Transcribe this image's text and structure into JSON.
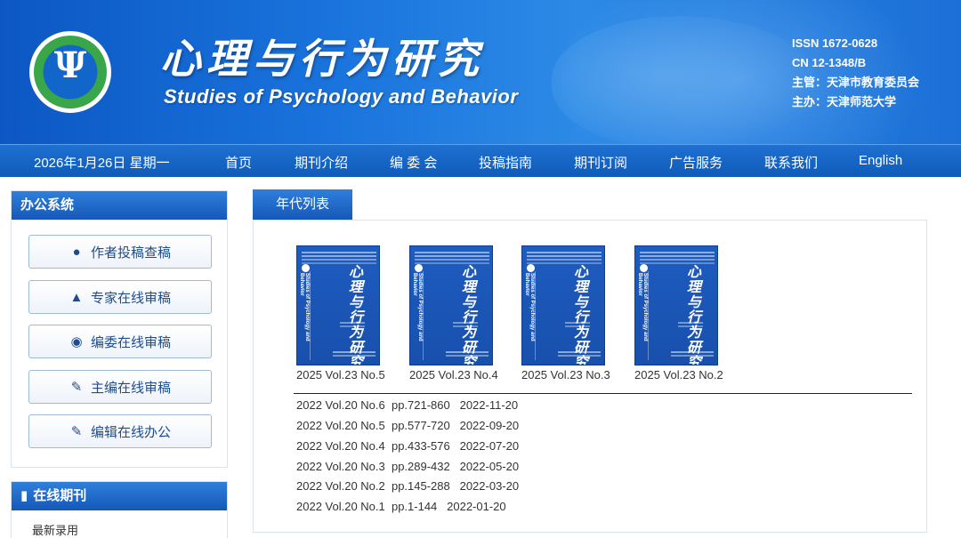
{
  "header": {
    "logo_name": "psychology-psi-logo",
    "title_cn": "心理与行为研究",
    "title_en": "Studies of Psychology and Behavior",
    "issn": "ISSN 1672-0628",
    "cn": "CN 12-1348/B",
    "supervisor": "主管：天津市教育委员会",
    "sponsor": "主办：天津师范大学"
  },
  "nav": {
    "date": "2026年1月26日 星期一",
    "items": [
      "首页",
      "期刊介绍",
      "编 委 会",
      "投稿指南",
      "期刊订阅",
      "广告服务",
      "联系我们",
      "English"
    ]
  },
  "sidebar": {
    "office_title": "办公系统",
    "buttons": [
      {
        "label": "作者投稿查稿",
        "icon": "user-icon"
      },
      {
        "label": "专家在线审稿",
        "icon": "graduation-cap-icon"
      },
      {
        "label": "编委在线审稿",
        "icon": "eye-icon"
      },
      {
        "label": "主编在线审稿",
        "icon": "pencil-icon"
      },
      {
        "label": "编辑在线办公",
        "icon": "edit-square-icon"
      }
    ],
    "journal_title": "在线期刊",
    "latest": "最新录用"
  },
  "main": {
    "tab_label": "年代列表",
    "covers": [
      {
        "label": "2025 Vol.23 No.5"
      },
      {
        "label": "2025 Vol.23 No.4"
      },
      {
        "label": "2025 Vol.23 No.3"
      },
      {
        "label": "2025 Vol.23 No.2"
      }
    ],
    "cover_title_cn": "心理与行为研究",
    "cover_title_en": "Studies of Psychology and Behavior",
    "issues": [
      "2022 Vol.20 No.6  pp.721-860   2022-11-20",
      "2022 Vol.20 No.5  pp.577-720   2022-09-20",
      "2022 Vol.20 No.4  pp.433-576   2022-07-20",
      "2022 Vol.20 No.3  pp.289-432   2022-05-20",
      "2022 Vol.20 No.2  pp.145-288   2022-03-20",
      "2022 Vol.20 No.1  pp.1-144   2022-01-20"
    ]
  },
  "colors": {
    "primary": "#1558b8",
    "banner": "#1a74dd",
    "text": "#333333"
  }
}
